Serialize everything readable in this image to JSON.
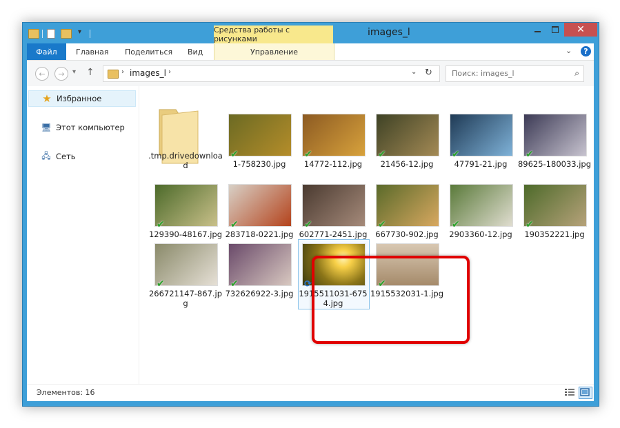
{
  "window": {
    "title": "images_l",
    "context_tab_label": "Средства работы с рисунками",
    "close_glyph": "✕"
  },
  "ribbon": {
    "file_label": "Файл",
    "tabs": [
      "Главная",
      "Поделиться",
      "Вид"
    ],
    "context_sub_label": "Управление",
    "expand_glyph": "⌄",
    "help_glyph": "?"
  },
  "address": {
    "back_glyph": "←",
    "forward_glyph": "→",
    "history_glyph": "▾",
    "up_glyph": "↑",
    "separator_glyph": "›",
    "path": "images_l",
    "dropdown_glyph": "⌄",
    "refresh_glyph": "↻"
  },
  "search": {
    "placeholder": "Поиск: images_l",
    "icon": "search-icon",
    "glyph": "⌕"
  },
  "nav_pane": {
    "items": [
      {
        "label": "Избранное",
        "icon": "star-icon",
        "glyph": "★"
      },
      {
        "label": "Этот компьютер",
        "icon": "computer-icon",
        "glyph": "🖥"
      },
      {
        "label": "Сеть",
        "icon": "network-icon",
        "glyph": "🖧"
      }
    ]
  },
  "files": [
    {
      "name": ".tmp.drivedownload",
      "kind": "folder"
    },
    {
      "name": "1-758230.jpg",
      "status": "synced",
      "colors": [
        "#6b6a23",
        "#b58d2a"
      ]
    },
    {
      "name": "14772-112.jpg",
      "status": "synced",
      "colors": [
        "#8c5a22",
        "#d8a23c"
      ]
    },
    {
      "name": "21456-12.jpg",
      "status": "synced",
      "colors": [
        "#3e4225",
        "#a48a55"
      ]
    },
    {
      "name": "47791-21.jpg",
      "status": "synced",
      "colors": [
        "#1f3a55",
        "#7fb2d8"
      ]
    },
    {
      "name": "89625-180033.jpg",
      "status": "synced",
      "colors": [
        "#3c3a55",
        "#c7c3cf"
      ]
    },
    {
      "name": "129390-48167.jpg",
      "status": "synced",
      "colors": [
        "#4c6a2a",
        "#c9c08a"
      ]
    },
    {
      "name": "283718-0221.jpg",
      "status": "synced",
      "colors": [
        "#d8d0c6",
        "#b4431c"
      ]
    },
    {
      "name": "602771-2451.jpg",
      "status": "synced",
      "colors": [
        "#4a3a30",
        "#a58a7a"
      ]
    },
    {
      "name": "667730-902.jpg",
      "status": "synced",
      "colors": [
        "#5a6a2a",
        "#d8a860"
      ]
    },
    {
      "name": "2903360-12.jpg",
      "status": "synced",
      "colors": [
        "#5a7a3a",
        "#e0ddd0"
      ]
    },
    {
      "name": "190352221.jpg",
      "status": "synced",
      "colors": [
        "#4d6a2a",
        "#b6a27a"
      ]
    },
    {
      "name": "266721147-867.jpg",
      "status": "synced",
      "colors": [
        "#8a8a6a",
        "#e6e0d6"
      ]
    },
    {
      "name": "732626922-3.jpg",
      "status": "synced",
      "colors": [
        "#6a4a6a",
        "#d8c8c0"
      ]
    },
    {
      "name": "1915511031-6754.jpg",
      "status": "syncing",
      "colors": [
        "#6a5a10",
        "#f8d048"
      ]
    },
    {
      "name": "1915532031-1.jpg",
      "status": "synced",
      "colors": [
        "#a58a6a",
        "#d8c8b2"
      ]
    }
  ],
  "status_bar": {
    "count_text": "Элементов: 16"
  },
  "icons": {
    "check": "✔",
    "sync": "⟳"
  }
}
